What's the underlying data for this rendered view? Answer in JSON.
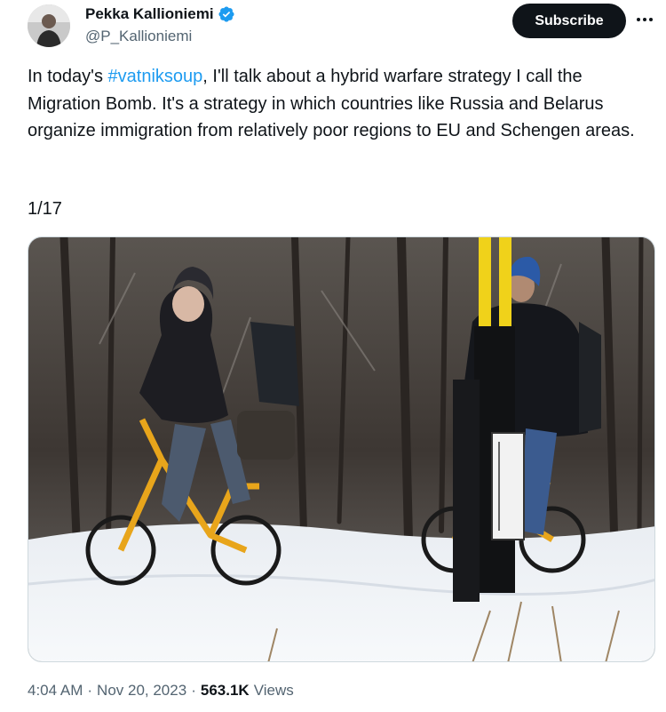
{
  "author": {
    "display_name": "Pekka Kallioniemi",
    "handle": "@P_Kallioniemi",
    "verified": true
  },
  "actions": {
    "subscribe_label": "Subscribe",
    "more_icon": "more-horizontal-icon"
  },
  "tweet": {
    "text_before": "In today's ",
    "hashtag": "#vatniksoup",
    "text_after": ", I'll talk about a hybrid warfare strategy I call the Migration Bomb. It's a strategy in which countries like Russia and Belarus organize immigration from relatively poor regions to EU and Schengen areas.",
    "thread_count": "1/17"
  },
  "meta": {
    "time": "4:04 AM",
    "separator": "·",
    "date": "Nov 20, 2023",
    "views_count": "563.1K",
    "views_label": "Views"
  },
  "colors": {
    "accent": "#1d9bf0",
    "text": "#0f1419",
    "muted": "#536471",
    "button_bg": "#0f1419"
  }
}
